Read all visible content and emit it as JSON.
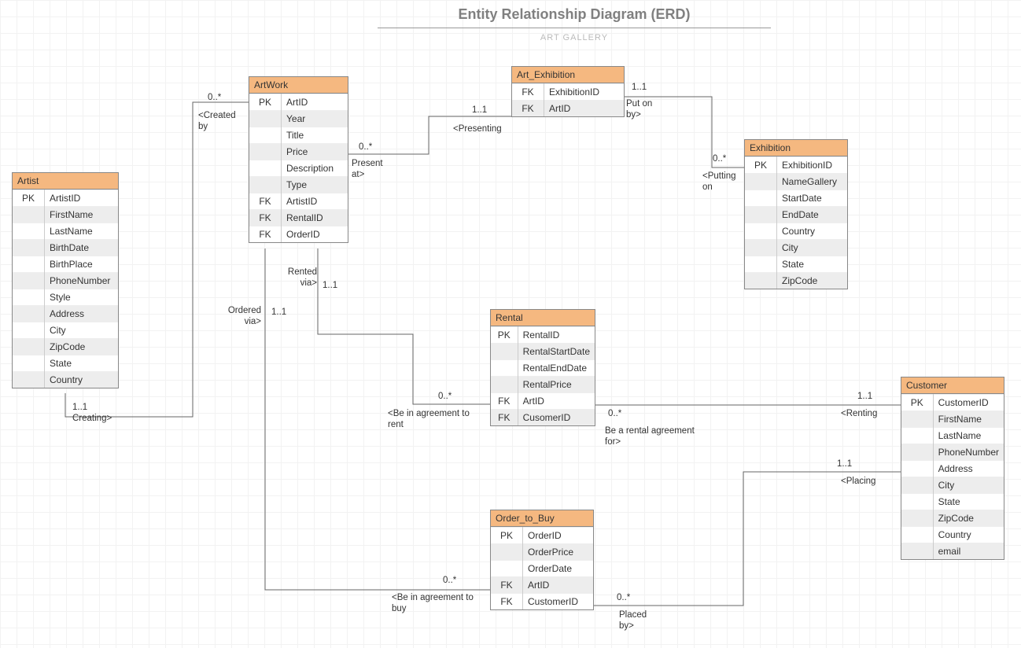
{
  "title": "Entity Relationship Diagram (ERD)",
  "subtitle": "ART GALLERY",
  "entities": {
    "artist": {
      "name": "Artist",
      "rows": [
        {
          "k": "PK",
          "n": "ArtistID"
        },
        {
          "k": "",
          "n": "FirstName"
        },
        {
          "k": "",
          "n": "LastName"
        },
        {
          "k": "",
          "n": "BirthDate"
        },
        {
          "k": "",
          "n": "BirthPlace"
        },
        {
          "k": "",
          "n": "PhoneNumber"
        },
        {
          "k": "",
          "n": "Style"
        },
        {
          "k": "",
          "n": "Address"
        },
        {
          "k": "",
          "n": "City"
        },
        {
          "k": "",
          "n": "ZipCode"
        },
        {
          "k": "",
          "n": "State"
        },
        {
          "k": "",
          "n": "Country"
        }
      ]
    },
    "artwork": {
      "name": "ArtWork",
      "rows": [
        {
          "k": "PK",
          "n": "ArtID"
        },
        {
          "k": "",
          "n": "Year"
        },
        {
          "k": "",
          "n": "Title"
        },
        {
          "k": "",
          "n": "Price"
        },
        {
          "k": "",
          "n": "Description"
        },
        {
          "k": "",
          "n": "Type"
        },
        {
          "k": "FK",
          "n": "ArtistID"
        },
        {
          "k": "FK",
          "n": "RentalID"
        },
        {
          "k": "FK",
          "n": "OrderID"
        }
      ]
    },
    "art_exhibition": {
      "name": "Art_Exhibition",
      "rows": [
        {
          "k": "FK",
          "n": "ExhibitionID"
        },
        {
          "k": "FK",
          "n": "ArtID"
        }
      ]
    },
    "exhibition": {
      "name": "Exhibition",
      "rows": [
        {
          "k": "PK",
          "n": "ExhibitionID"
        },
        {
          "k": "",
          "n": "NameGallery"
        },
        {
          "k": "",
          "n": "StartDate"
        },
        {
          "k": "",
          "n": "EndDate"
        },
        {
          "k": "",
          "n": "Country"
        },
        {
          "k": "",
          "n": "City"
        },
        {
          "k": "",
          "n": "State"
        },
        {
          "k": "",
          "n": "ZipCode"
        }
      ]
    },
    "rental": {
      "name": "Rental",
      "rows": [
        {
          "k": "PK",
          "n": "RentalID"
        },
        {
          "k": "",
          "n": "RentalStartDate"
        },
        {
          "k": "",
          "n": "RentalEndDate"
        },
        {
          "k": "",
          "n": "RentalPrice"
        },
        {
          "k": "FK",
          "n": "ArtID"
        },
        {
          "k": "FK",
          "n": "CusomerID"
        }
      ]
    },
    "order": {
      "name": "Order_to_Buy",
      "rows": [
        {
          "k": "PK",
          "n": "OrderID"
        },
        {
          "k": "",
          "n": "OrderPrice"
        },
        {
          "k": "",
          "n": "OrderDate"
        },
        {
          "k": "FK",
          "n": "ArtID"
        },
        {
          "k": "FK",
          "n": "CustomerID"
        }
      ]
    },
    "customer": {
      "name": "Customer",
      "rows": [
        {
          "k": "PK",
          "n": "CustomerID"
        },
        {
          "k": "",
          "n": "FirstName"
        },
        {
          "k": "",
          "n": "LastName"
        },
        {
          "k": "",
          "n": "PhoneNumber"
        },
        {
          "k": "",
          "n": "Address"
        },
        {
          "k": "",
          "n": "City"
        },
        {
          "k": "",
          "n": "State"
        },
        {
          "k": "",
          "n": "ZipCode"
        },
        {
          "k": "",
          "n": "Country"
        },
        {
          "k": "",
          "n": "email"
        }
      ]
    }
  },
  "labels": {
    "c1": "0..*",
    "c2": "<Created by",
    "c3": "1..1",
    "c4": "Creating>",
    "c5": "0..*",
    "c6": "Present at>",
    "c7": "1..1",
    "c8": "<Presenting",
    "c9": "1..1",
    "c10": "Put on by>",
    "c11": "0..*",
    "c12": "<Putting on",
    "c13": "Rented via>",
    "c14": "1..1",
    "c15": "Ordered via>",
    "c16": "1..1",
    "c17": "0..*",
    "c18": "<Be in agreement to rent",
    "c19": "0..*",
    "c20": "Be a rental agreement for>",
    "c21": "1..1",
    "c22": "<Renting",
    "c23": "0..*",
    "c24": "<Be in agreement to buy",
    "c25": "0..*",
    "c26": "Placed by>",
    "c27": "1..1",
    "c28": "<Placing"
  }
}
